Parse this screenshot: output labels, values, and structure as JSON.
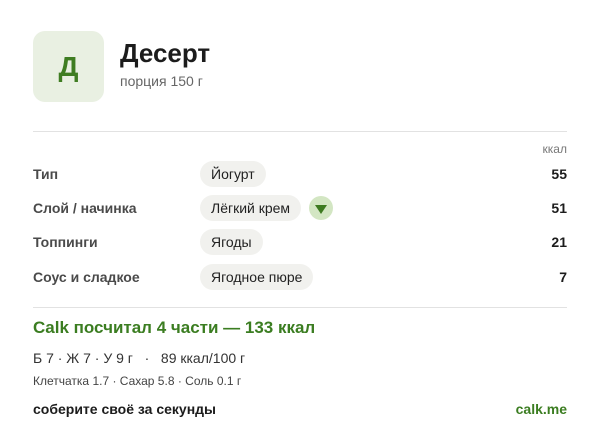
{
  "header": {
    "avatar_letter": "Д",
    "title": "Десерт",
    "subtitle": "порция 150 г"
  },
  "table": {
    "unit_label": "ккал",
    "rows": [
      {
        "label": "Тип",
        "value": "Йогурт",
        "kcal": "55"
      },
      {
        "label": "Слой / начинка",
        "value": "Лёгкий крем",
        "kcal": "51"
      },
      {
        "label": "Топпинги",
        "value": "Ягоды",
        "kcal": "21"
      },
      {
        "label": "Соус и сладкое",
        "value": "Ягодное пюре",
        "kcal": "7"
      }
    ]
  },
  "summary": {
    "headline": "Calk посчитал 4 части — 133 ккал",
    "macros": "Б 7 · Ж 7 · У 9 г   ·   89 ккал/100 г",
    "extras": "Клетчатка 1.7 · Сахар 5.8 · Соль 0.1 г"
  },
  "footer": {
    "tagline": "соберите своё за секунды",
    "link": "calk.me"
  },
  "colors": {
    "accent": "#3b7d21",
    "avatar_bg": "#e9f0e2",
    "chip_bg": "#f1f1ee",
    "dropdown_bg": "#d3e6c3"
  },
  "icons": {
    "dropdown": "chevron-down-icon"
  }
}
